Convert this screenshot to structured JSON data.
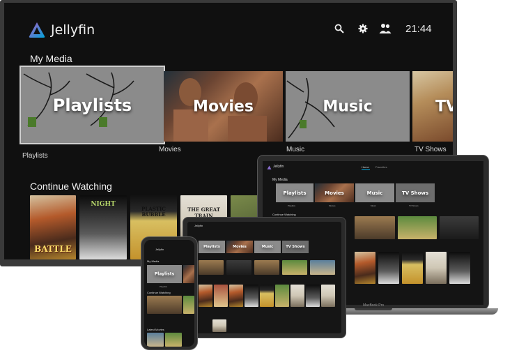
{
  "tv": {
    "app_name": "Jellyfin",
    "clock": "21:44",
    "icons": [
      "search-icon",
      "gear-icon",
      "users-icon"
    ],
    "sections": {
      "my_media": "My Media",
      "continue_watching": "Continue Watching"
    },
    "libraries": [
      {
        "title": "Playlists",
        "caption": "Playlists"
      },
      {
        "title": "Movies",
        "caption": "Movies"
      },
      {
        "title": "Music",
        "caption": "Music"
      },
      {
        "title": "TV",
        "caption": "TV Shows"
      }
    ],
    "continue_watching": [
      {
        "poster_text": "BATTLE"
      },
      {
        "poster_text": "NIGHT"
      },
      {
        "poster_text": "PLASTIC BUBBLE"
      },
      {
        "poster_text": "THE GREAT TRAIN"
      }
    ]
  },
  "laptop": {
    "app_name": "Jellyfin",
    "tabs": [
      "Home",
      "Favorites"
    ],
    "sections": {
      "my_media": "My Media",
      "continue_watching": "Continue Watching"
    },
    "libraries": [
      {
        "title": "Playlists",
        "caption": "Playlists"
      },
      {
        "title": "Movies",
        "caption": "Movies"
      },
      {
        "title": "Music",
        "caption": "Music"
      },
      {
        "title": "TV Shows",
        "caption": "TV Shows"
      }
    ],
    "model": "MacBook Pro"
  },
  "tablet": {
    "app_name": "Jellyfin",
    "libraries": [
      {
        "title": "Playlists"
      },
      {
        "title": "Movies"
      },
      {
        "title": "Music"
      },
      {
        "title": "TV Shows"
      }
    ]
  },
  "phone": {
    "app_name": "Jellyfin",
    "sections": {
      "my_media": "My Media",
      "continue_watching": "Continue Watching",
      "latest_movies": "Latest Movies"
    },
    "libraries": [
      {
        "title": "Playlists",
        "caption": "Playlists"
      }
    ]
  },
  "colors": {
    "background": "#101010",
    "logo_gradient_start": "#aa5cc3",
    "logo_gradient_end": "#00a4dc",
    "library_card": "#8b8b8b"
  }
}
